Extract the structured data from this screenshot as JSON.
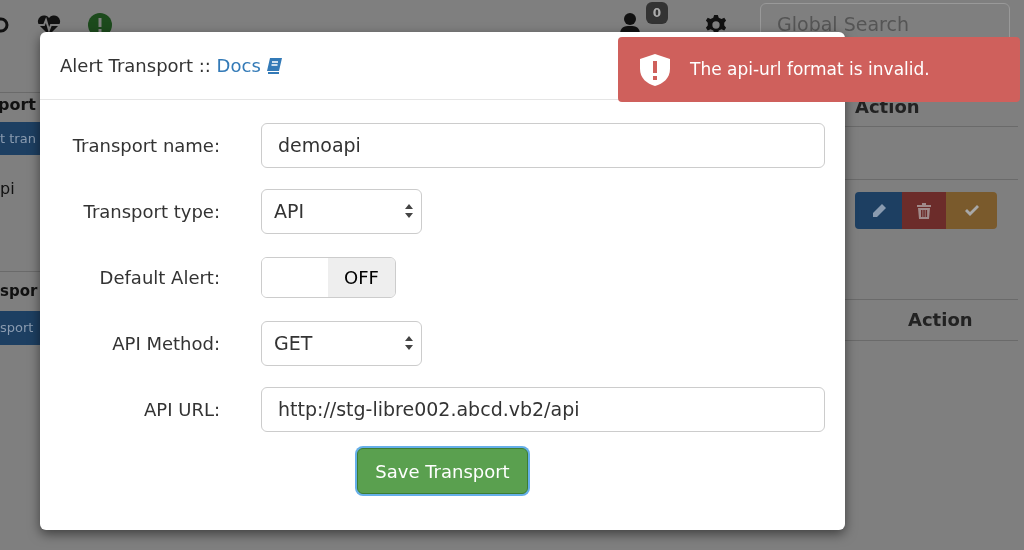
{
  "navbar": {
    "notification_count": "0",
    "search_placeholder": "Global Search"
  },
  "background": {
    "left": {
      "header": "port",
      "button": "t tran",
      "row_text": "pi",
      "header_2": "spor",
      "button_2": "sport"
    },
    "right": {
      "header": "Action",
      "header_2": "Action"
    }
  },
  "modal": {
    "title": "Alert Transport ::",
    "docs_link": "Docs",
    "fields": [
      {
        "kind": "text",
        "label": "Transport name:",
        "value": "demoapi"
      },
      {
        "kind": "select",
        "label": "Transport type:",
        "value": "API"
      },
      {
        "kind": "toggle",
        "label": "Default Alert:",
        "on": false,
        "state_label": "OFF"
      },
      {
        "kind": "select",
        "label": "API Method:",
        "value": "GET"
      },
      {
        "kind": "text",
        "label": "API URL:",
        "value": "http://stg-libre002.abcd.vb2/api"
      }
    ],
    "save_button": "Save Transport"
  },
  "toast": {
    "message": "The api-url format is invalid."
  }
}
